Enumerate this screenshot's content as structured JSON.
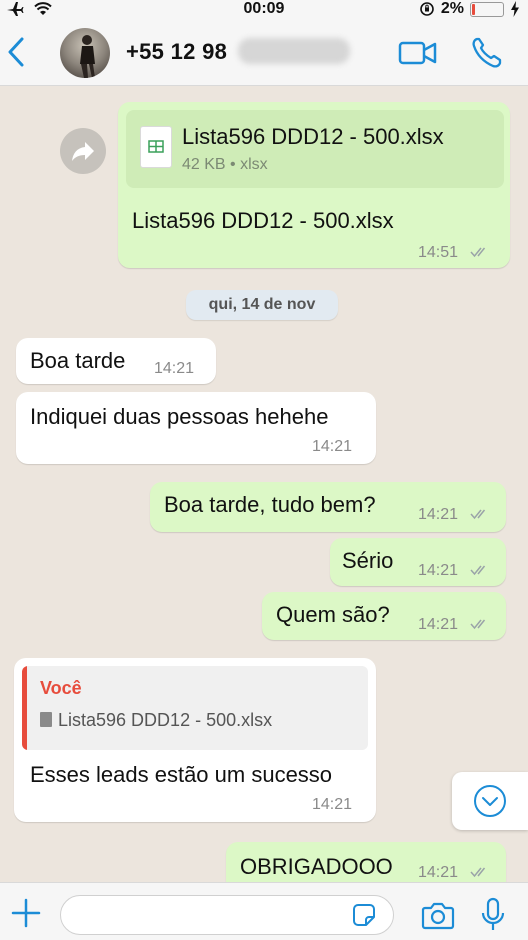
{
  "status_bar": {
    "time": "00:09",
    "battery": "2%",
    "battery_level": 0.02,
    "left_icons": [
      "airplane-icon",
      "wifi-icon"
    ],
    "right_icons": [
      "orientation-lock-icon",
      "battery-icon",
      "charging-icon"
    ]
  },
  "header": {
    "contact_name": "+55 12 98",
    "icons": [
      "back-chevron-icon",
      "video-call-icon",
      "phone-icon"
    ]
  },
  "colors": {
    "accent": "#1c8cd6",
    "outgoing_bubble": "#dcf8c6",
    "incoming_bubble": "#ffffff",
    "chat_background": "#ece5dd",
    "quote_author": "#e74c3c",
    "read_tick": "#9aa3a8"
  },
  "messages": {
    "doc_msg": {
      "file_name": "Lista596 DDD12 - 500.xlsx",
      "file_meta": "42 KB • xlsx",
      "caption": "Lista596 DDD12 - 500.xlsx",
      "time": "14:51"
    },
    "date_separator": "qui, 14 de nov",
    "m1": {
      "text": "Boa tarde",
      "time": "14:21"
    },
    "m2": {
      "text": "Indiquei duas pessoas hehehe",
      "time": "14:21"
    },
    "m3": {
      "text": "Boa tarde, tudo bem?",
      "time": "14:21"
    },
    "m4": {
      "text": "Sério",
      "time": "14:21"
    },
    "m5": {
      "text": "Quem são?",
      "time": "14:21"
    },
    "m6": {
      "quote_author": "Você",
      "quote_text": "Lista596 DDD12 - 500.xlsx",
      "text": "Esses leads estão um sucesso",
      "time": "14:21"
    },
    "m7": {
      "text": "OBRIGADOOO",
      "time": "14:21"
    }
  },
  "input": {
    "placeholder": "",
    "value": ""
  }
}
